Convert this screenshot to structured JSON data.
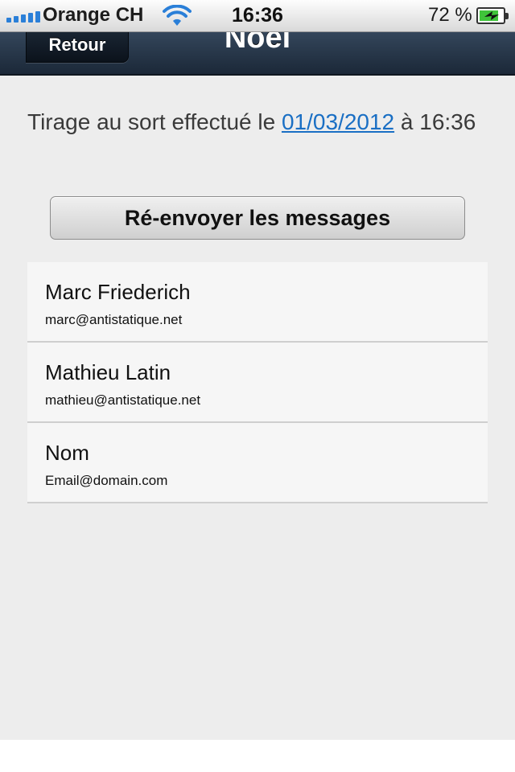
{
  "status_bar": {
    "carrier": "Orange CH",
    "time": "16:36",
    "battery_percent": "72 %",
    "battery_level": 0.72,
    "signal_bars": 5
  },
  "nav": {
    "back_label": "Retour",
    "title": "Noël"
  },
  "draw_info": {
    "prefix": "Tirage au sort effectué le ",
    "date": "01/03/2012",
    "suffix": " à 16:36"
  },
  "resend_button": "Ré-envoyer les messages",
  "contacts": [
    {
      "name": "Marc Friederich",
      "email": "marc@antistatique.net"
    },
    {
      "name": "Mathieu Latin",
      "email": "mathieu@antistatique.net"
    },
    {
      "name": "Nom",
      "email": "Email@domain.com"
    }
  ],
  "colors": {
    "link": "#1a6fc4",
    "navbar": "#1b2838",
    "signal": "#2a7fd8",
    "battery": "#3fc43a"
  }
}
